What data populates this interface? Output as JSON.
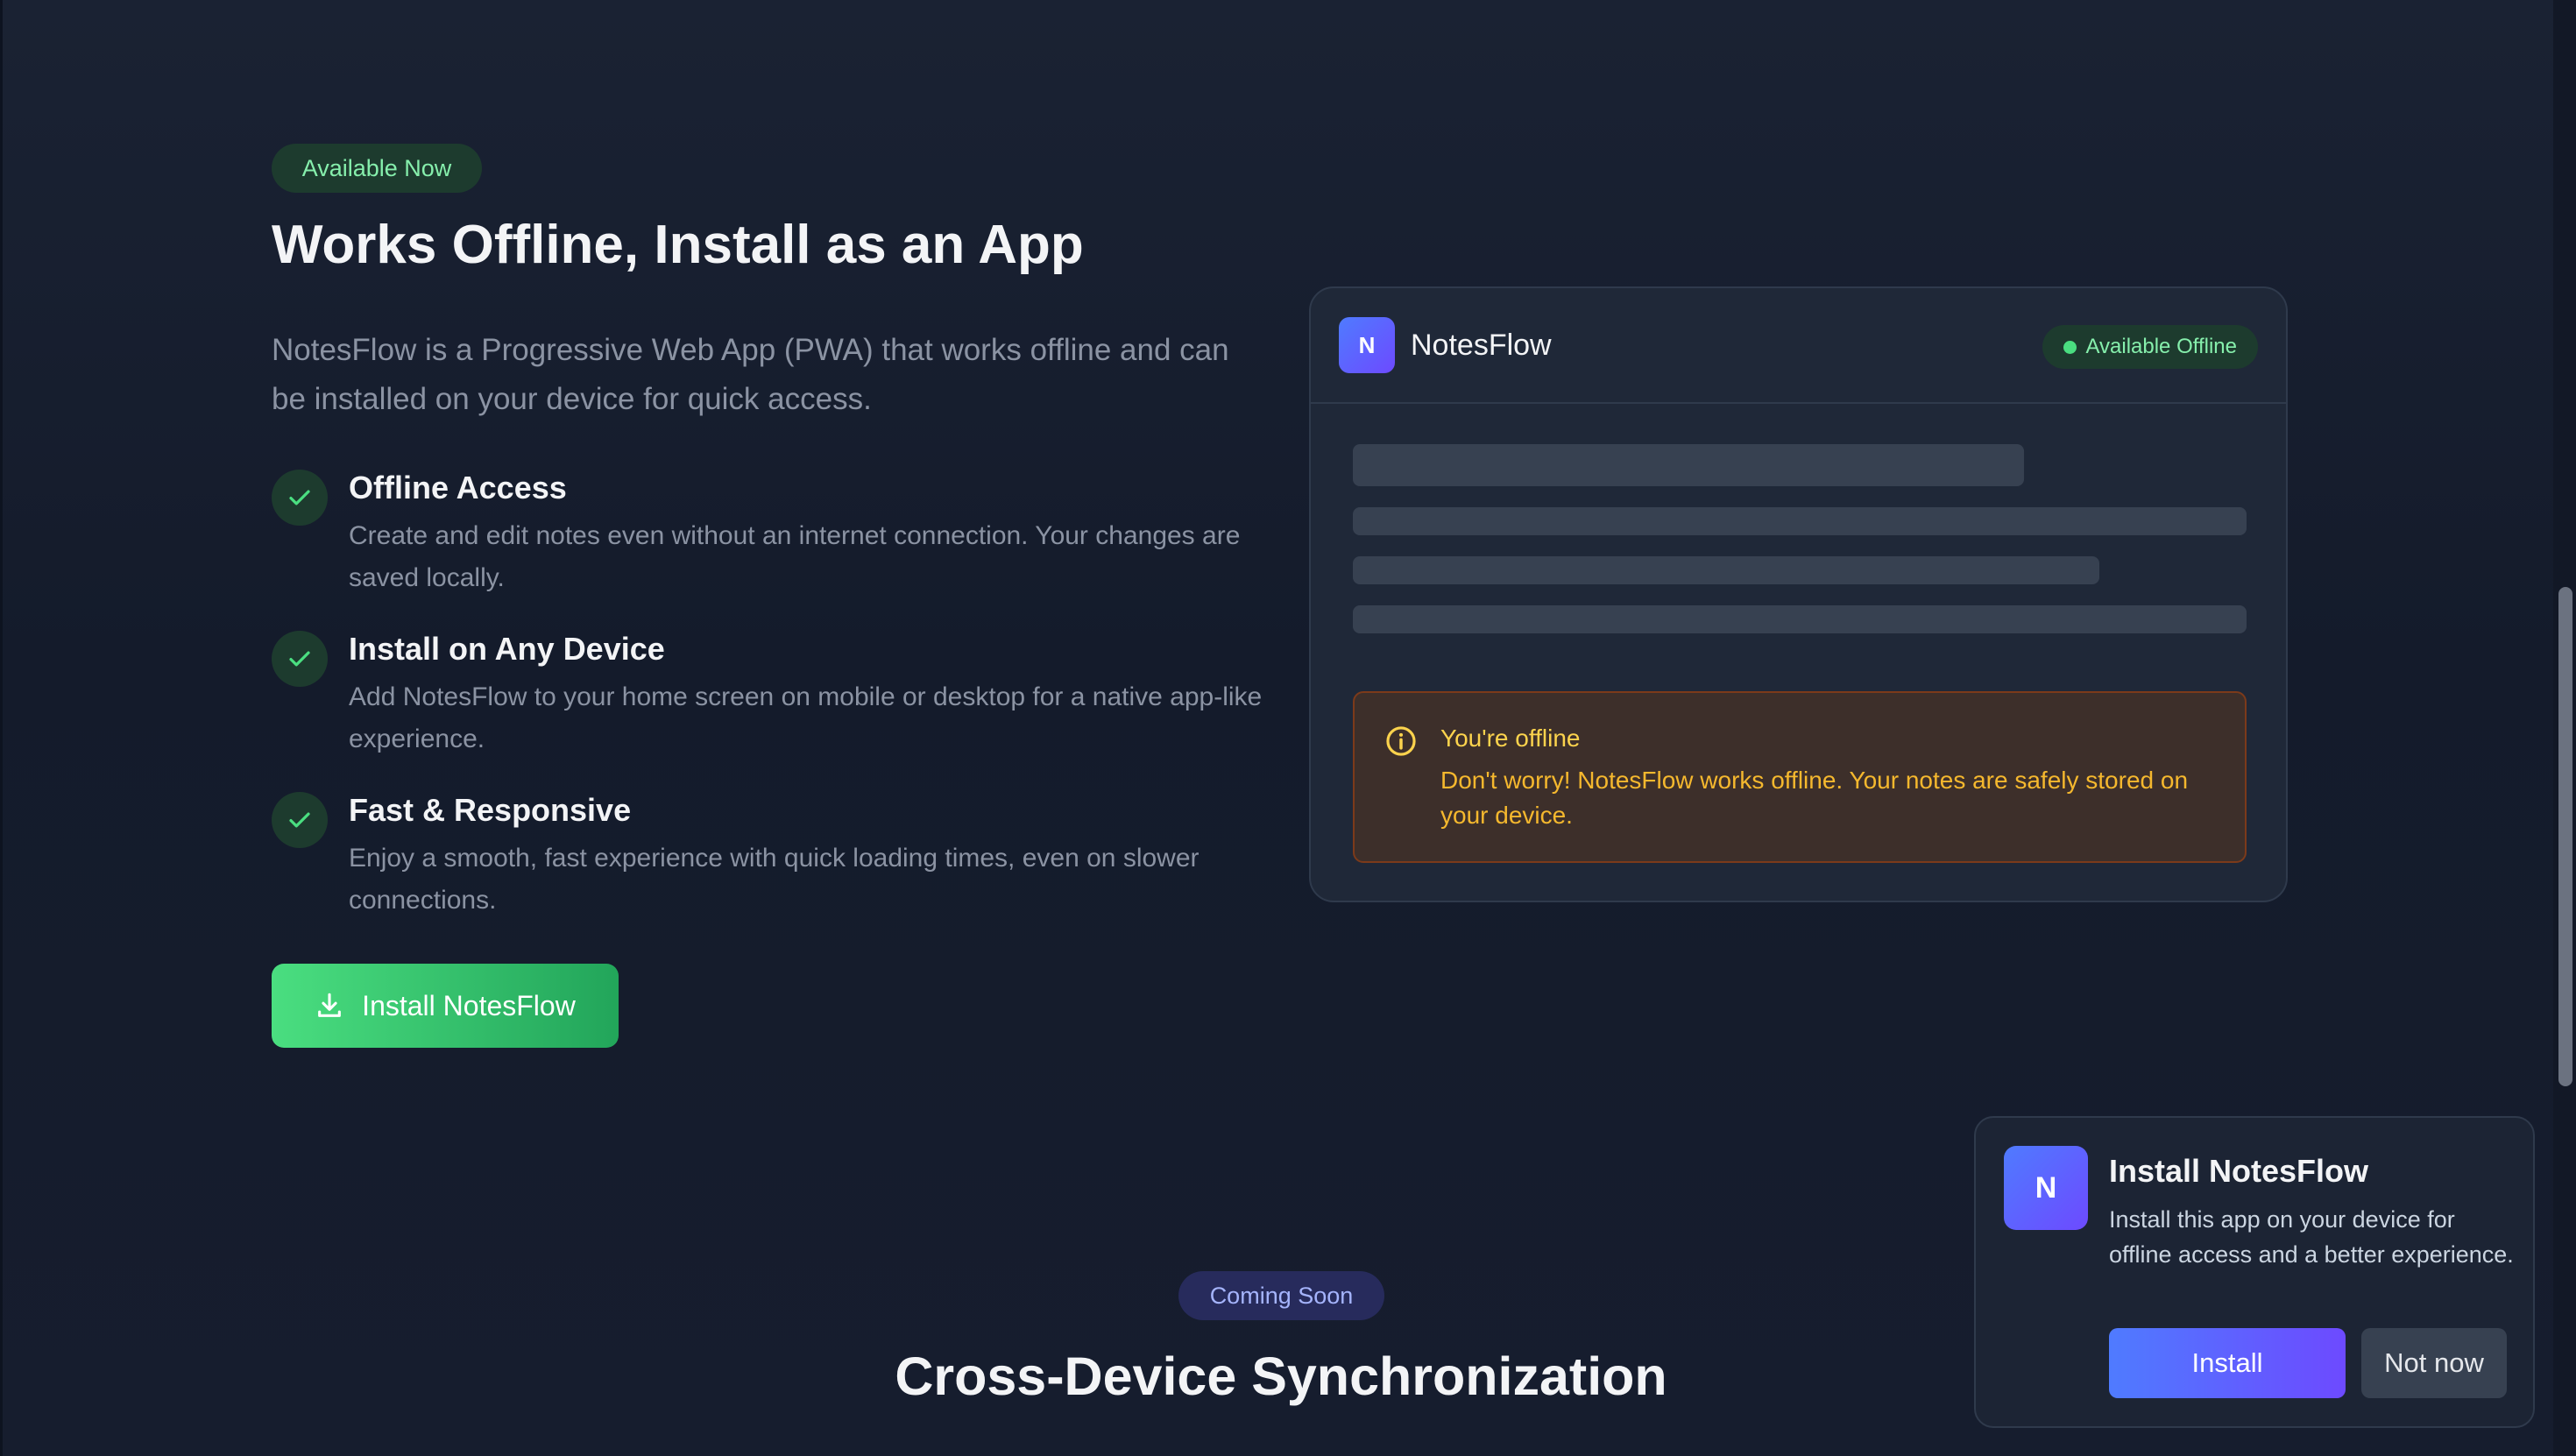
{
  "offline_section": {
    "badge": "Available Now",
    "title": "Works Offline, Install as an App",
    "lead": "NotesFlow is a Progressive Web App (PWA) that works offline and can be installed on your device for quick access.",
    "features": [
      {
        "title": "Offline Access",
        "description": "Create and edit notes even without an internet connection. Your changes are saved locally.",
        "icon": "check-icon"
      },
      {
        "title": "Install on Any Device",
        "description": "Add NotesFlow to your home screen on mobile or desktop for a native app-like experience.",
        "icon": "check-icon"
      },
      {
        "title": "Fast & Responsive",
        "description": "Enjoy a smooth, fast experience with quick loading times, even on slower connections.",
        "icon": "check-icon"
      }
    ],
    "install_button_label": "Install NotesFlow",
    "install_button_icon": "download-icon"
  },
  "preview": {
    "logo_letter": "N",
    "app_name": "NotesFlow",
    "status_badge": "Available Offline",
    "alert": {
      "icon": "info-icon",
      "title": "You're offline",
      "message": "Don't worry! NotesFlow works offline. Your notes are safely stored on your device."
    }
  },
  "sync_section": {
    "badge": "Coming Soon",
    "title": "Cross-Device Synchronization"
  },
  "install_prompt": {
    "logo_letter": "N",
    "title": "Install NotesFlow",
    "message": "Install this app on your device for offline access and a better experience.",
    "install_label": "Install",
    "dismiss_label": "Not now"
  },
  "colors": {
    "background": "#151c2c",
    "success": "#4ade80",
    "brand": "#4f7bff",
    "warning": "#f5b82e"
  }
}
